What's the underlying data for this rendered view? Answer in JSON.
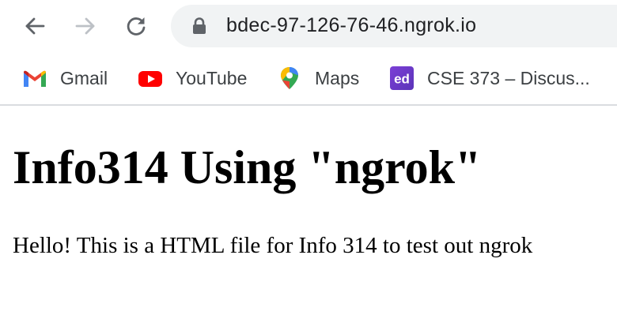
{
  "browser": {
    "url": "bdec-97-126-76-46.ngrok.io",
    "nav": {
      "back_icon": "arrow-left-icon",
      "forward_icon": "arrow-right-icon",
      "reload_icon": "reload-icon",
      "forward_enabled": false
    },
    "security_icon": "lock-icon"
  },
  "bookmarks": [
    {
      "label": "Gmail",
      "icon": "gmail-icon"
    },
    {
      "label": "YouTube",
      "icon": "youtube-icon"
    },
    {
      "label": "Maps",
      "icon": "maps-icon"
    },
    {
      "label": "CSE 373 – Discus...",
      "icon": "ed-icon",
      "icon_text": "ed"
    }
  ],
  "page": {
    "heading": "Info314 Using \"ngrok\"",
    "paragraph": "Hello! This is a HTML file for Info 314 to test out ngrok"
  },
  "colors": {
    "omnibox_bg": "#f1f3f4",
    "icon_gray": "#5f6368",
    "icon_disabled": "#bdc1c6",
    "youtube_red": "#ff0000",
    "ed_purple": "#6d3ec1"
  }
}
